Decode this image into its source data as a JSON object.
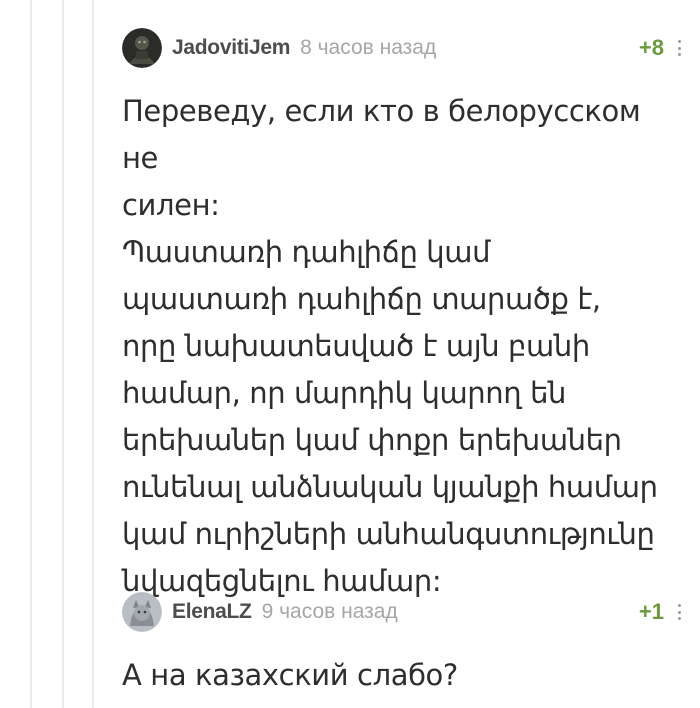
{
  "comments": [
    {
      "username": "JadovitiJem",
      "time": "8 часов назад",
      "rating": "+8",
      "avatar_icon": "user-avatar-dark-icon",
      "body": "Переведу, если кто в белорусском не\nсилен:\nՊաստառի դահլիճը կամ\nպաստառի դահլիճը տարածք է,\nորը նախատեսված է այն բանի\nհամար, որ մարդիկ կարող են\nերեխաներ կամ փոքր երեխաներ\nունենալ անձնական կյանքի համար\nկամ ուրիշների անհանգստությունը\nնվազեցնելու համար:"
    },
    {
      "username": "ElenaLZ",
      "time": "9 часов назад",
      "rating": "+1",
      "avatar_icon": "user-avatar-cat-icon",
      "body": "А на казахский слабо?"
    }
  ],
  "colors": {
    "rating_positive": "#6a9a3a",
    "username": "#4d4d4d",
    "timestamp": "#a6a6a6",
    "thread_line": "#e9ebee"
  }
}
